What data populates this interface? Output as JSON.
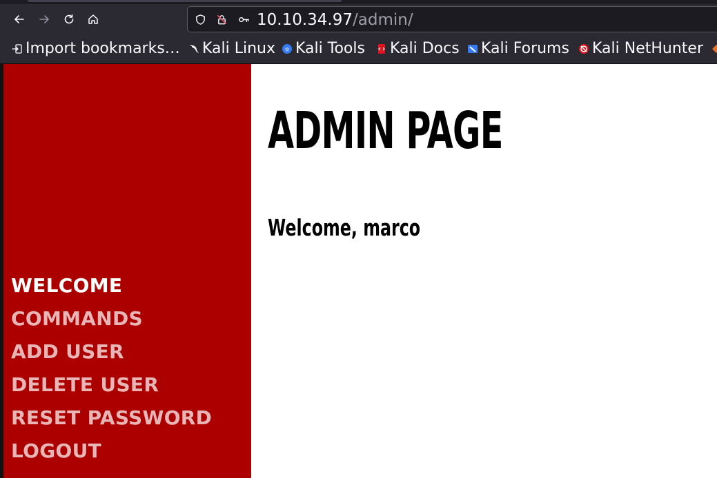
{
  "browser": {
    "url_host": "10.10.34.97",
    "url_path": "/admin/",
    "bookmarks": [
      {
        "label": "Import bookmarks…",
        "icon": "import-icon"
      },
      {
        "label": "Kali Linux",
        "icon": "kali-dragon-icon"
      },
      {
        "label": "Kali Tools",
        "icon": "kali-tools-icon"
      },
      {
        "label": "Kali Docs",
        "icon": "kali-docs-icon"
      },
      {
        "label": "Kali Forums",
        "icon": "kali-forums-icon"
      },
      {
        "label": "Kali NetHunter",
        "icon": "kali-nethunter-icon"
      }
    ]
  },
  "sidebar": {
    "items": [
      {
        "label": "WELCOME",
        "active": true
      },
      {
        "label": "COMMANDS",
        "active": false
      },
      {
        "label": "ADD USER",
        "active": false
      },
      {
        "label": "DELETE USER",
        "active": false
      },
      {
        "label": "RESET PASSWORD",
        "active": false
      },
      {
        "label": "LOGOUT",
        "active": false
      }
    ]
  },
  "main": {
    "title": "ADMIN PAGE",
    "welcome": "Welcome, marco"
  },
  "colors": {
    "sidebar_bg": "#ac0000",
    "sidebar_active": "#ffffff",
    "sidebar_inactive": "#e8b6b6",
    "chrome_bg": "#2b2a33",
    "urlbar_bg": "#1c1b22"
  }
}
